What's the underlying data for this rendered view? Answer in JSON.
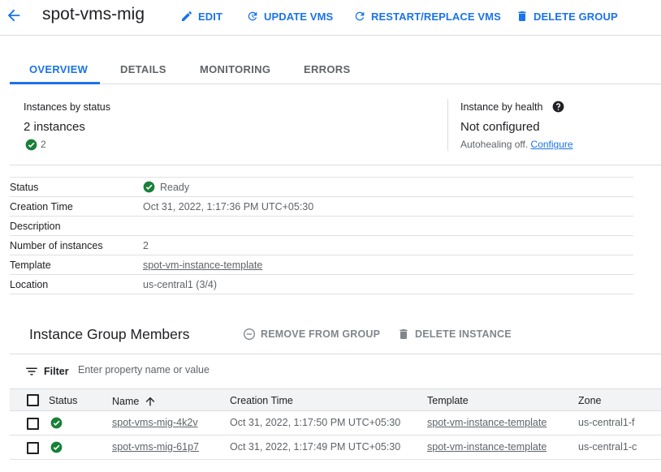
{
  "header": {
    "title": "spot-vms-mig",
    "actions": {
      "edit": "EDIT",
      "update_vms": "UPDATE VMS",
      "restart_replace": "RESTART/REPLACE VMS",
      "delete_group": "DELETE GROUP"
    }
  },
  "tabs": [
    "OVERVIEW",
    "DETAILS",
    "MONITORING",
    "ERRORS"
  ],
  "status_card": {
    "instances_by_status_label": "Instances by status",
    "instances_count": "2 instances",
    "ok_count": "2",
    "health_label": "Instance by health",
    "health_value": "Not configured",
    "autohealing_text": "Autohealing off.",
    "configure_link": "Configure"
  },
  "properties": [
    {
      "key": "Status",
      "value": "Ready"
    },
    {
      "key": "Creation Time",
      "value": "Oct 31, 2022, 1:17:36 PM UTC+05:30"
    },
    {
      "key": "Description",
      "value": ""
    },
    {
      "key": "Number of instances",
      "value": "2"
    },
    {
      "key": "Template",
      "value": "spot-vm-instance-template"
    },
    {
      "key": "Location",
      "value": "us-central1 (3/4)"
    }
  ],
  "members": {
    "title": "Instance Group Members",
    "remove_label": "REMOVE FROM GROUP",
    "delete_label": "DELETE INSTANCE",
    "filter_label": "Filter",
    "filter_placeholder": "Enter property name or value",
    "columns": {
      "status": "Status",
      "name": "Name",
      "creation_time": "Creation Time",
      "template": "Template",
      "zone": "Zone"
    },
    "rows": [
      {
        "name": "spot-vms-mig-4k2v",
        "creation_time": "Oct 31, 2022, 1:17:50 PM UTC+05:30",
        "template": "spot-vm-instance-template",
        "zone": "us-central1-f"
      },
      {
        "name": "spot-vms-mig-61p7",
        "creation_time": "Oct 31, 2022, 1:17:49 PM UTC+05:30",
        "template": "spot-vm-instance-template",
        "zone": "us-central1-c"
      }
    ]
  },
  "colors": {
    "accent": "#1a73e8",
    "success": "#188038",
    "muted": "#5f6368",
    "disabled": "#80868b"
  }
}
